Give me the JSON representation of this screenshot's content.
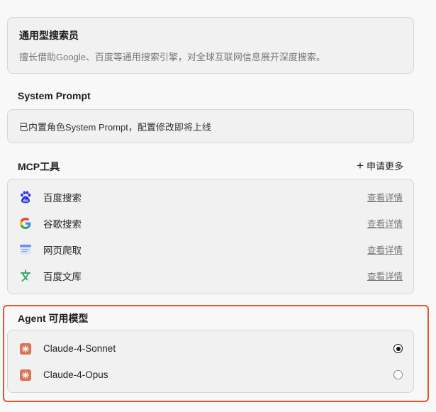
{
  "agent": {
    "title": "通用型搜索员",
    "description": "擅长借助Google、百度等通用搜索引擎，对全球互联网信息展开深度搜索。"
  },
  "system_prompt": {
    "label": "System Prompt",
    "text": "已内置角色System Prompt，配置修改即将上线"
  },
  "mcp": {
    "label": "MCP工具",
    "more_label": "申请更多",
    "detail_label": "查看详情",
    "tools": [
      {
        "name": "百度搜索",
        "icon": "baidu-paw-icon"
      },
      {
        "name": "谷歌搜索",
        "icon": "google-icon"
      },
      {
        "name": "网页爬取",
        "icon": "webpage-icon"
      },
      {
        "name": "百度文库",
        "icon": "wenku-icon"
      }
    ]
  },
  "models": {
    "label": "Agent 可用模型",
    "items": [
      {
        "name": "Claude-4-Sonnet",
        "selected": true,
        "icon": "claude-icon"
      },
      {
        "name": "Claude-4-Opus",
        "selected": false,
        "icon": "claude-icon"
      }
    ]
  },
  "colors": {
    "highlight": "#e2552f",
    "baidu_blue": "#2932e1",
    "wenku_green": "#3aa76d",
    "claude_orange": "#d97452"
  }
}
